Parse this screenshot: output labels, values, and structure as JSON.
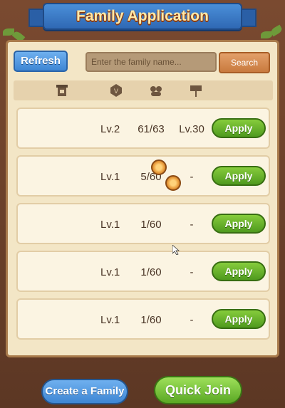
{
  "header": {
    "title": "Family Application"
  },
  "toolbar": {
    "refresh_label": "Refresh",
    "search_placeholder": "Enter the family name...",
    "search_label": "Search"
  },
  "columns": {
    "icons": [
      "family-banner-icon",
      "level-badge-icon",
      "members-icon",
      "requirement-sign-icon"
    ]
  },
  "families": [
    {
      "name": "",
      "level": "Lv.2",
      "members": "61/63",
      "requirement": "Lv.30",
      "action": "Apply"
    },
    {
      "name": "",
      "level": "Lv.1",
      "members": "5/60",
      "requirement": "-",
      "action": "Apply"
    },
    {
      "name": "",
      "level": "Lv.1",
      "members": "1/60",
      "requirement": "-",
      "action": "Apply"
    },
    {
      "name": "",
      "level": "Lv.1",
      "members": "1/60",
      "requirement": "-",
      "action": "Apply"
    },
    {
      "name": "",
      "level": "Lv.1",
      "members": "1/60",
      "requirement": "-",
      "action": "Apply"
    }
  ],
  "footer": {
    "create_label": "Create a Family",
    "quick_join_label": "Quick Join"
  },
  "colors": {
    "apply_green": "#5aa824",
    "refresh_blue": "#3e86d4",
    "search_orange": "#c97a3e",
    "panel_bg": "#f3e6c6",
    "wood": "#5c3724"
  }
}
